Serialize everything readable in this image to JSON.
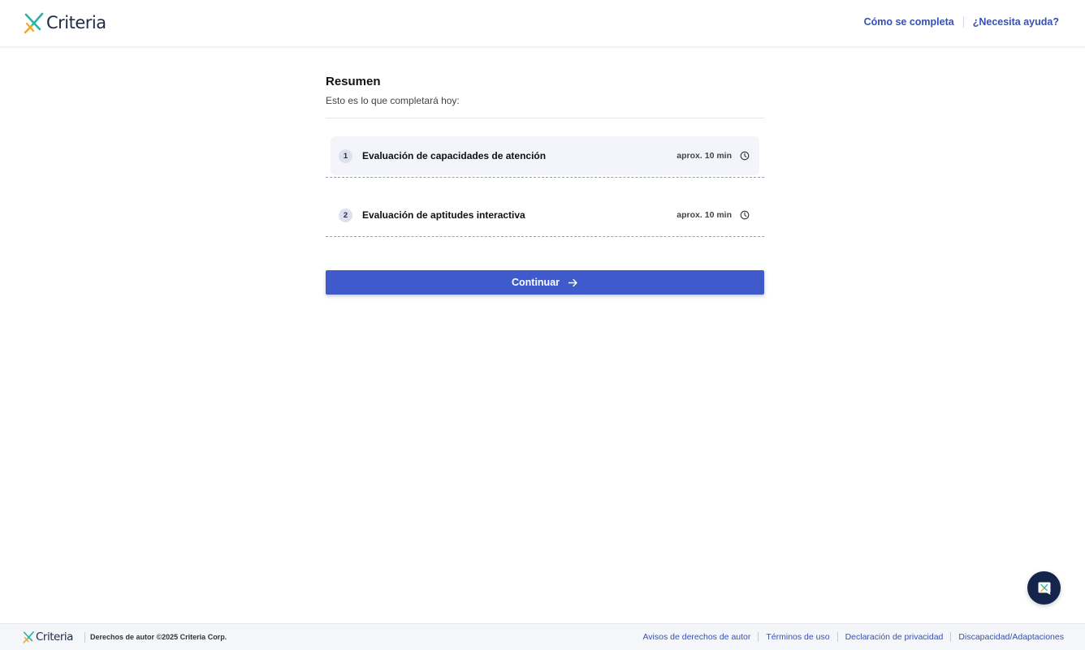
{
  "header": {
    "brand": "Criteria",
    "links": [
      {
        "label": "Cómo se completa"
      },
      {
        "label": "¿Necesita ayuda?"
      }
    ]
  },
  "summary": {
    "title": "Resumen",
    "subtitle": "Esto es lo que completará hoy:",
    "tasks": [
      {
        "number": "1",
        "name": "Evaluación de capacidades de atención",
        "duration": "aprox. 10 min",
        "icon": "clock-icon"
      },
      {
        "number": "2",
        "name": "Evaluación de aptitudes interactiva",
        "duration": "aprox. 10 min",
        "icon": "clock-icon"
      }
    ],
    "continue_label": "Continuar"
  },
  "chat": {
    "icon": "chat-widget-icon"
  },
  "footer": {
    "brand": "Criteria",
    "copyright": "Derechos de autor ©2025 Criteria Corp.",
    "links": [
      {
        "label": "Avisos de derechos de autor"
      },
      {
        "label": "Términos de uso"
      },
      {
        "label": "Declaración de privacidad"
      },
      {
        "label": "Discapacidad/Adaptaciones"
      }
    ]
  },
  "colors": {
    "accent": "#3f5bcb",
    "link": "#3550b8",
    "brand_dark": "#1f2a44",
    "chat_bg": "#15244a",
    "logo_teal": "#2bb3a3",
    "logo_orange": "#f5a623"
  }
}
